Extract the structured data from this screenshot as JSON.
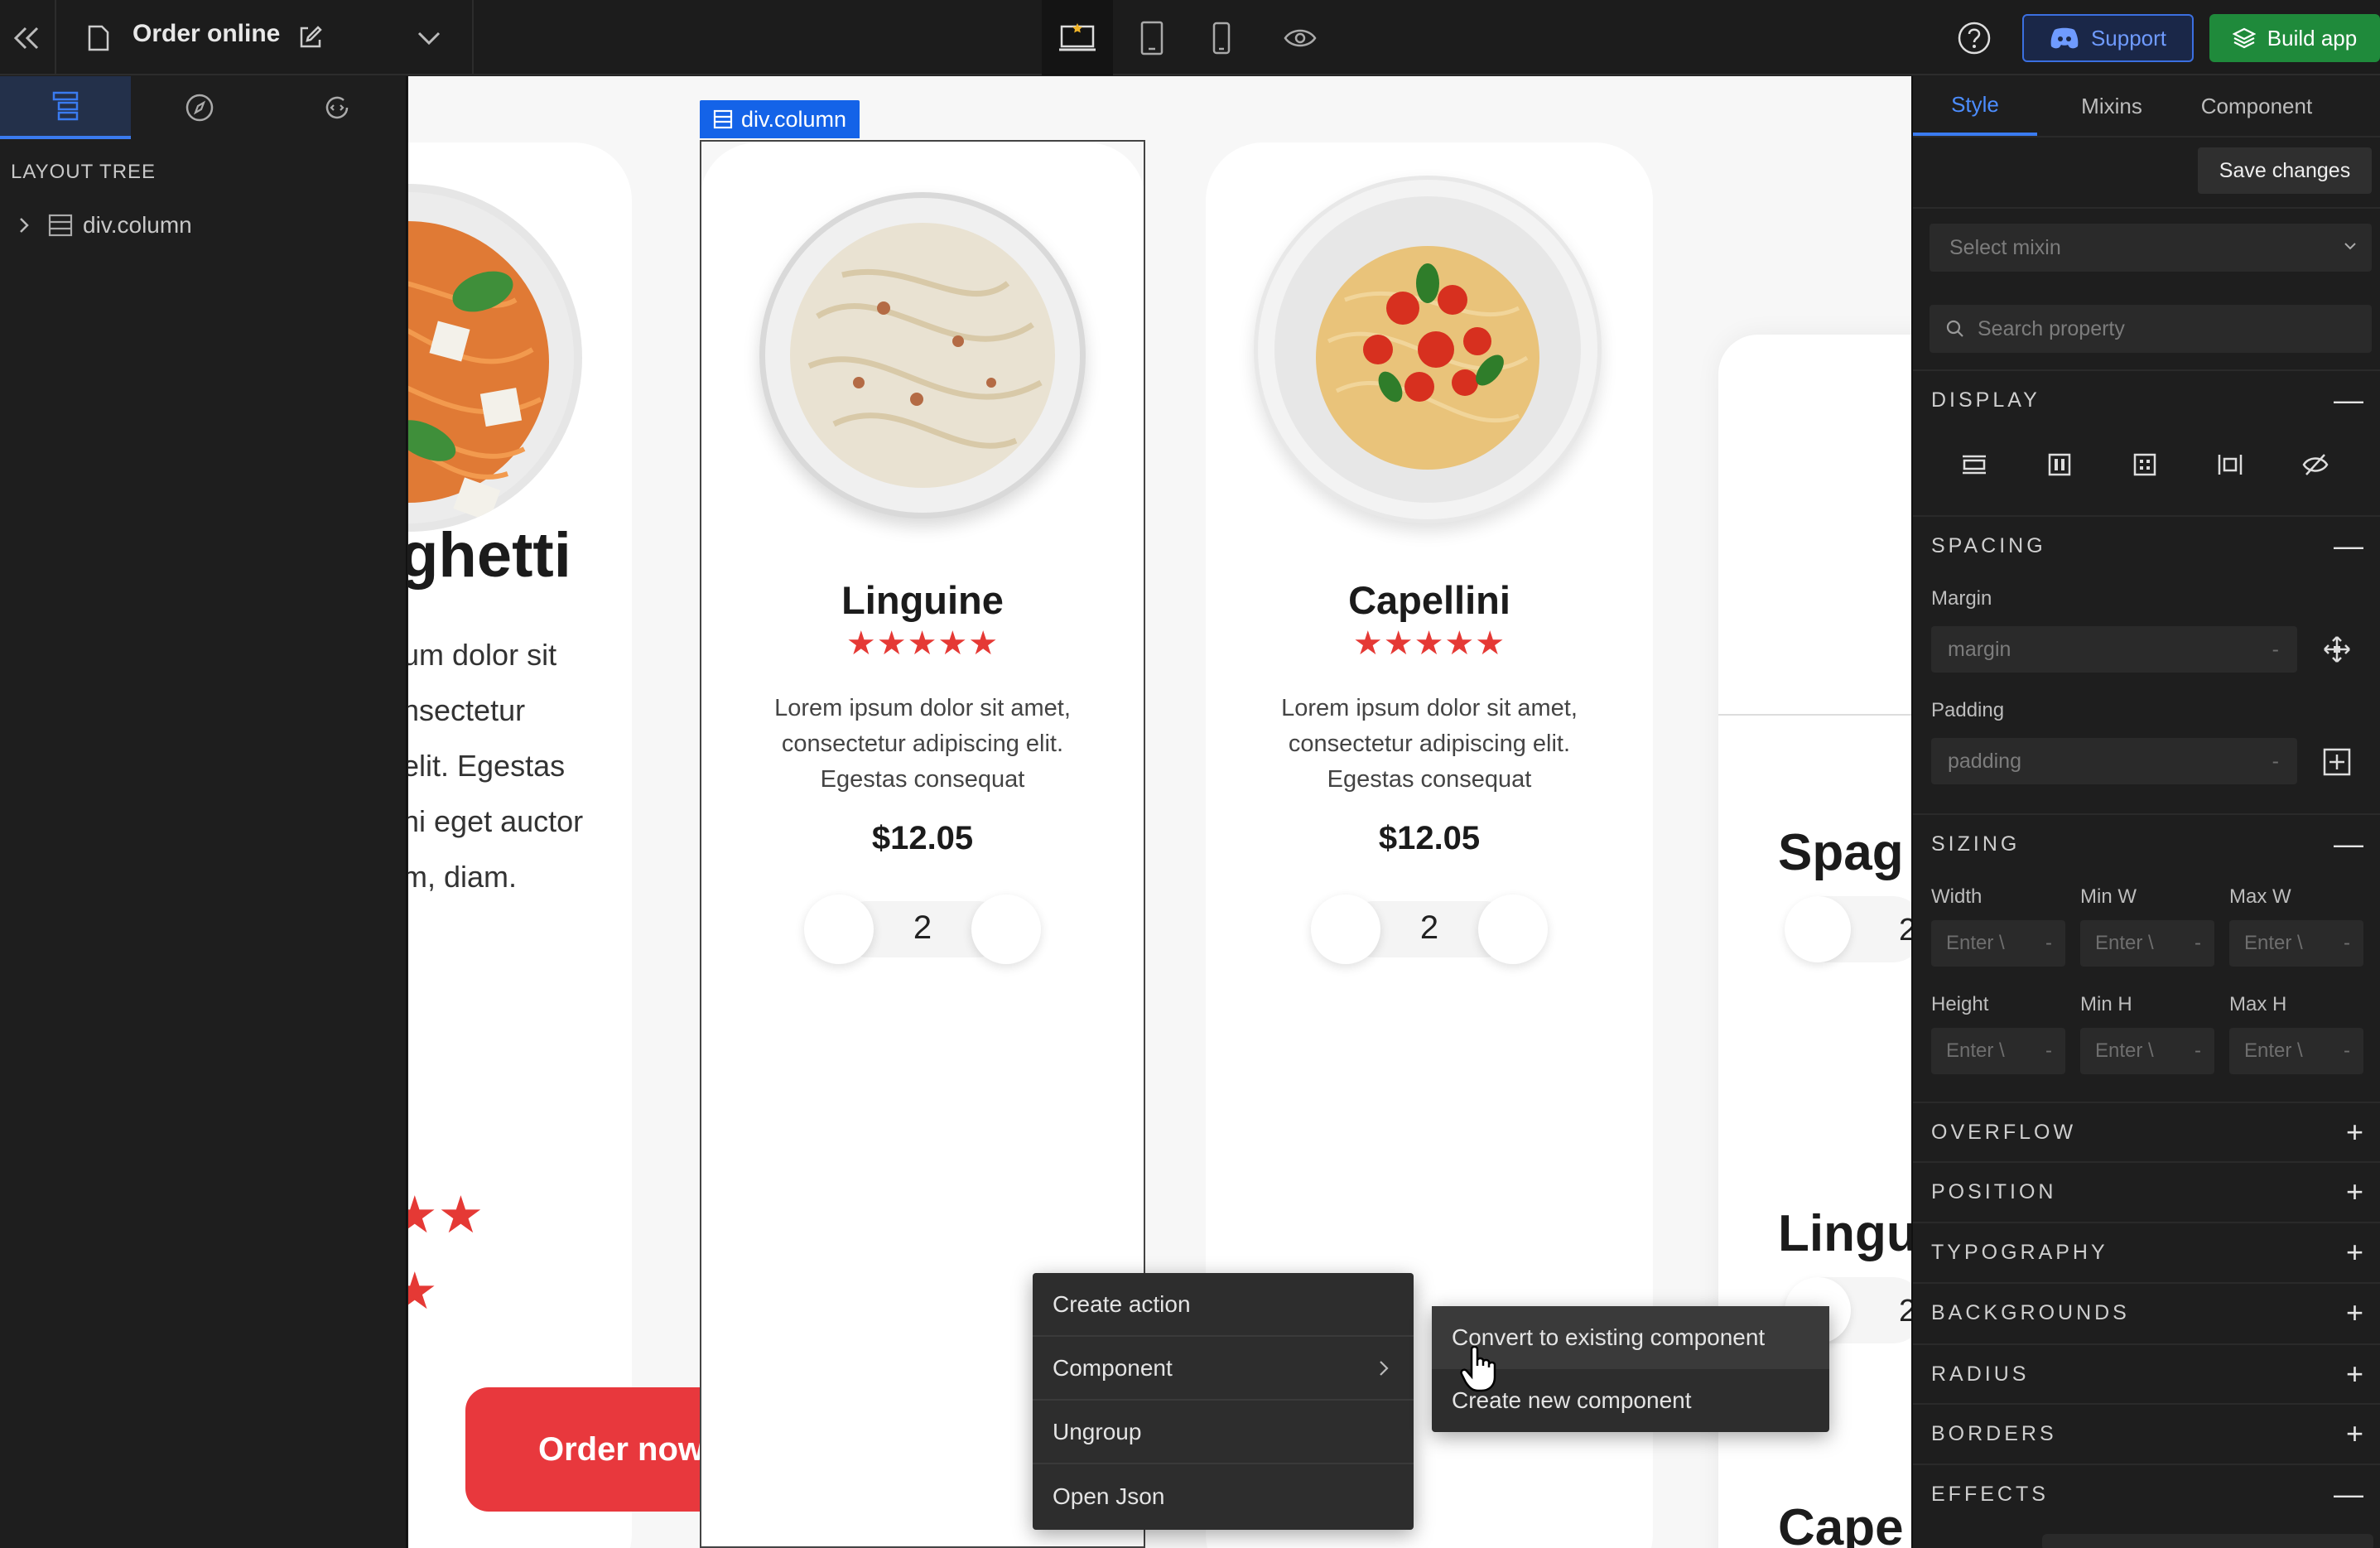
{
  "topbar": {
    "page_name": "Order online",
    "support_label": "Support",
    "build_label": "Build app"
  },
  "left_panel": {
    "title": "LAYOUT TREE",
    "tree": [
      {
        "label": "div.column"
      }
    ]
  },
  "canvas": {
    "selection_label": "div.column",
    "partial_left_card": {
      "title": "ghetti",
      "desc_lines": [
        "um dolor sit",
        "nsectetur",
        "elit. Egestas",
        "hi eget auctor",
        "m, diam."
      ],
      "button": "Order now"
    },
    "cards": [
      {
        "name": "Linguine",
        "stars": "★★★★★",
        "desc_lines": [
          "Lorem ipsum dolor sit amet,",
          "consectetur adipiscing elit.",
          "Egestas consequat"
        ],
        "price": "$12.05",
        "qty": "2"
      },
      {
        "name": "Capellini",
        "stars": "★★★★★",
        "desc_lines": [
          "Lorem ipsum dolor sit amet,",
          "consectetur adipiscing elit.",
          "Egestas consequat"
        ],
        "price": "$12.05",
        "qty": "2"
      }
    ],
    "right_card": {
      "items": [
        "Spag",
        "Lingu",
        "Cape"
      ],
      "qty": "2"
    }
  },
  "context_menu": {
    "items": [
      "Create action",
      "Component",
      "Ungroup",
      "Open Json"
    ],
    "submenu": [
      "Convert to existing component",
      "Create new component"
    ]
  },
  "right_panel": {
    "tabs": [
      "Style",
      "Mixins",
      "Component"
    ],
    "save_label": "Save changes",
    "mixin_placeholder": "Select mixin",
    "search_placeholder": "Search property",
    "sections": {
      "display": "DISPLAY",
      "spacing": "SPACING",
      "sizing": "SIZING",
      "overflow": "OVERFLOW",
      "position": "POSITION",
      "typography": "TYPOGRAPHY",
      "backgrounds": "BACKGROUNDS",
      "radius": "RADIUS",
      "borders": "BORDERS",
      "effects": "EFFECTS"
    },
    "margin_label": "Margin",
    "margin_placeholder": "margin",
    "padding_label": "Padding",
    "padding_placeholder": "padding",
    "sizing_labels": [
      "Width",
      "Min W",
      "Max W",
      "Height",
      "Min H",
      "Max H"
    ],
    "sizing_placeholder": "Enter \\",
    "dash": "-"
  },
  "colors": {
    "accent": "#3a7bf0",
    "build_green": "#1f8a3b",
    "star_red": "#e53935",
    "order_red": "#e8383d"
  }
}
